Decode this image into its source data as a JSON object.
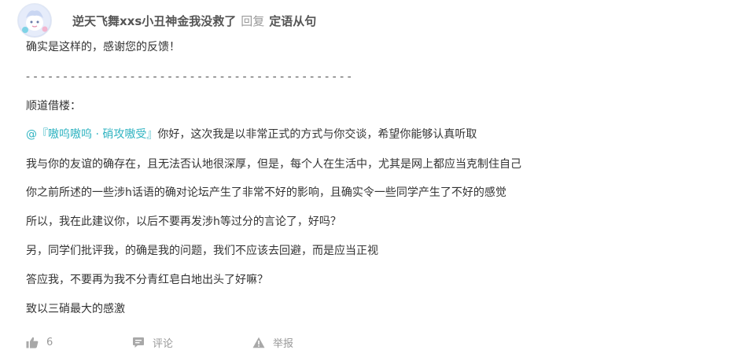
{
  "comment": {
    "author": "逆天飞舞xxs小丑神金我没救了",
    "reply_word": "回复",
    "reply_to": "定语从句"
  },
  "body": {
    "line1": "确实是这样的，感谢您的反馈！",
    "divider": "- - - - - - - - - - - - - - - - - - - - - - - - - - - - - - - - - - - - - - - - - - - -",
    "line3": "顺道借楼：",
    "mention": "@『嗷呜嗷呜 · 硝攻嗷受』",
    "line4_rest": "你好，这次我是以非常正式的方式与你交谈，希望你能够认真听取",
    "line5": "我与你的友谊的确存在，且无法否认地很深厚，但是，每个人在生活中，尤其是网上都应当克制住自己",
    "line6": "你之前所述的一些涉h话语的确对论坛产生了非常不好的影响，且确实令一些同学产生了不好的感觉",
    "line7": "所以，我在此建议你，以后不要再发涉h等过分的言论了，好吗？",
    "line8": "另，同学们批评我，的确是我的问题，我们不应该去回避，而是应当正视",
    "line9": "答应我，不要再为我不分青红皂白地出头了好嘛？",
    "line10": "致以三硝最大的感激"
  },
  "footer": {
    "like_count": "6",
    "comment_label": "评论",
    "report_label": "举报"
  },
  "icons": {
    "like": "thumbs-up-icon",
    "comment": "comment-bubble-icon",
    "report": "warning-triangle-icon"
  },
  "colors": {
    "mention": "#2fb3c1",
    "text": "#333333",
    "muted": "#999999"
  }
}
